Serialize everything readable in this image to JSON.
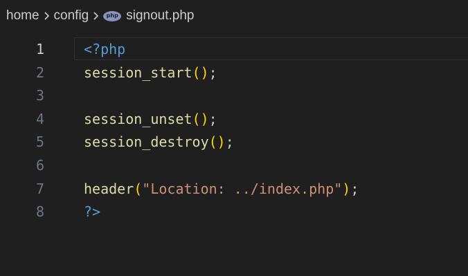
{
  "breadcrumb": {
    "home": "home",
    "config": "config",
    "file_icon": "php-file-icon",
    "file": "signout.php",
    "separator_icon": "chevron-right-icon"
  },
  "editor": {
    "active_line": 1,
    "lines": [
      {
        "number": "1",
        "tokens": [
          {
            "text": "<?php",
            "kind": "tag"
          }
        ]
      },
      {
        "number": "2",
        "tokens": [
          {
            "text": "session_start",
            "kind": "fn"
          },
          {
            "text": "()",
            "kind": "paren"
          },
          {
            "text": ";",
            "kind": "punct"
          }
        ]
      },
      {
        "number": "3",
        "tokens": []
      },
      {
        "number": "4",
        "tokens": [
          {
            "text": "session_unset",
            "kind": "fn"
          },
          {
            "text": "()",
            "kind": "paren"
          },
          {
            "text": ";",
            "kind": "punct"
          }
        ]
      },
      {
        "number": "5",
        "tokens": [
          {
            "text": "session_destroy",
            "kind": "fn"
          },
          {
            "text": "()",
            "kind": "paren"
          },
          {
            "text": ";",
            "kind": "punct"
          }
        ]
      },
      {
        "number": "6",
        "tokens": []
      },
      {
        "number": "7",
        "tokens": [
          {
            "text": "header",
            "kind": "fn"
          },
          {
            "text": "(",
            "kind": "paren"
          },
          {
            "text": "\"Location: ../index.php\"",
            "kind": "str"
          },
          {
            "text": ")",
            "kind": "paren"
          },
          {
            "text": ";",
            "kind": "punct"
          }
        ]
      },
      {
        "number": "8",
        "tokens": [
          {
            "text": "?>",
            "kind": "tag"
          }
        ]
      }
    ]
  },
  "colors": {
    "background": "#1f1f1f",
    "function": "#dcdcaa",
    "bracket": "#ffd700",
    "string": "#ce9178",
    "php_tag": "#569cd6",
    "line_number": "#6e7681",
    "line_number_active": "#cccccc"
  }
}
